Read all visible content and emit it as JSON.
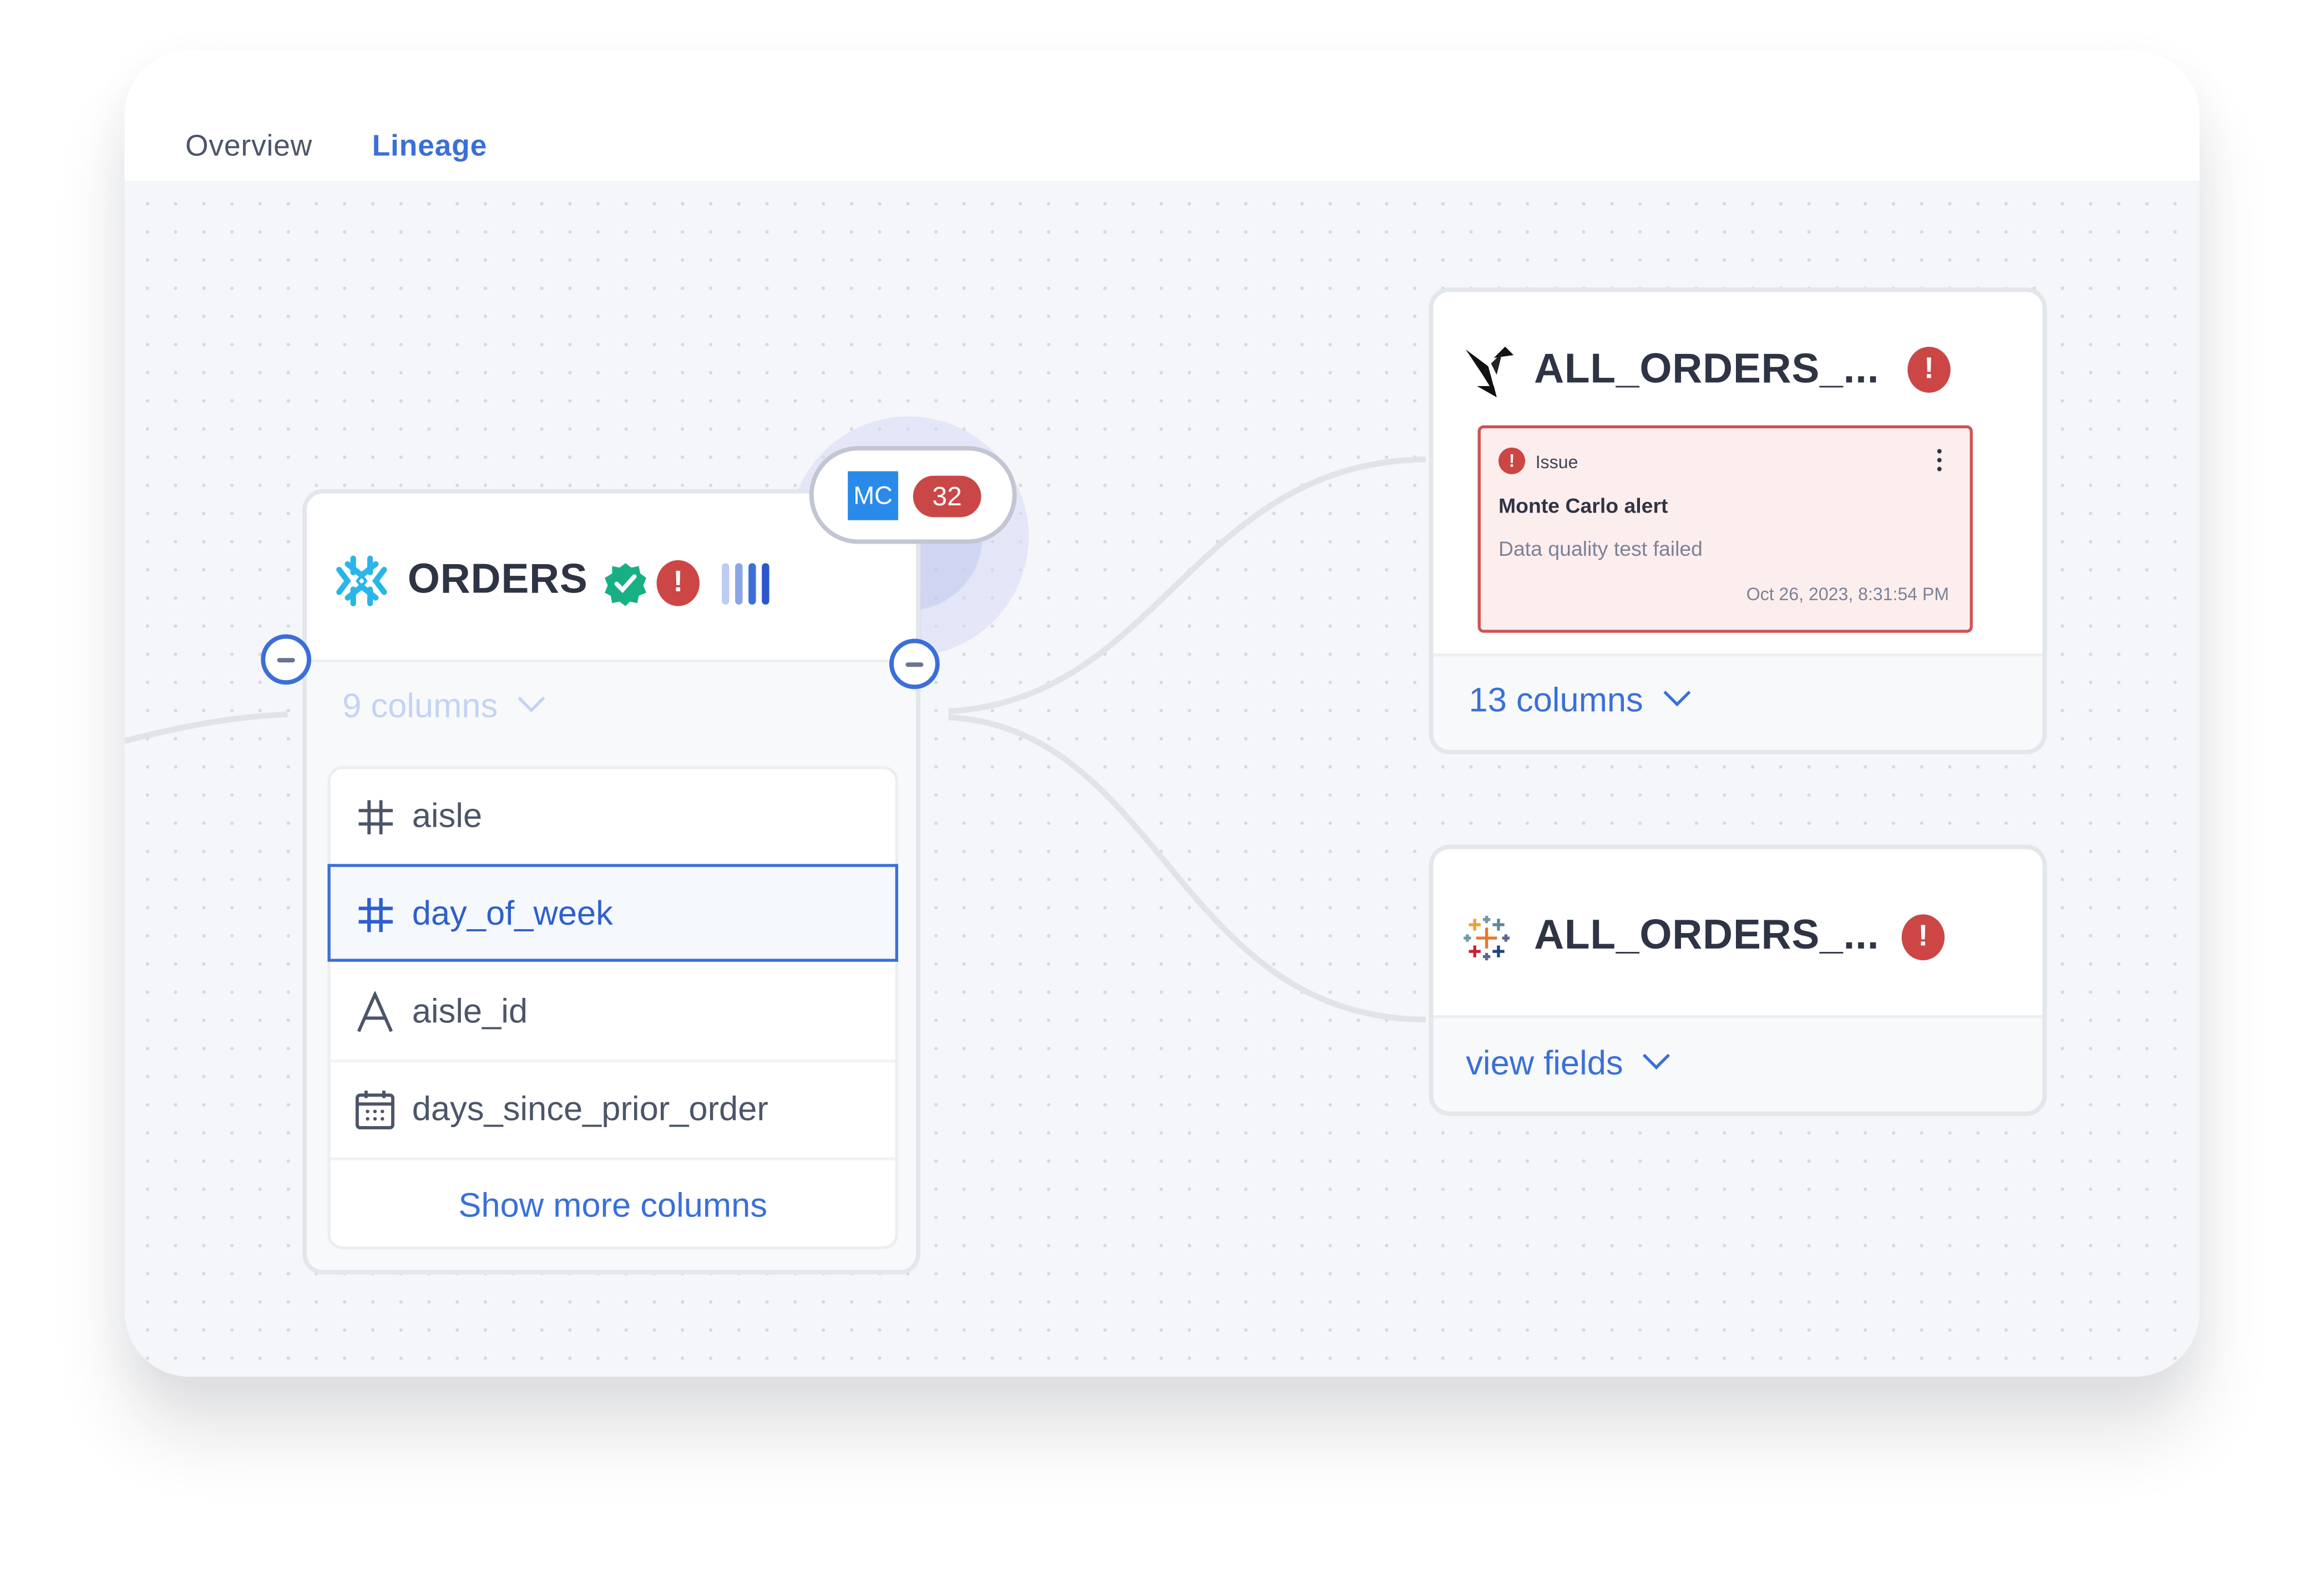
{
  "tabs": [
    {
      "label": "Overview",
      "active": false
    },
    {
      "label": "Lineage",
      "active": true
    }
  ],
  "colors": {
    "accent": "#3b6fd8",
    "alert": "#cc4646",
    "verified": "#17b084",
    "mc_brand": "#2a8aea",
    "canvas_bg": "#f4f6f9"
  },
  "orders_node": {
    "title": "ORDERS",
    "source_icon": "snowflake-icon",
    "verified_icon": "verified-badge-icon",
    "alert_symbol": "!",
    "importance_bars": {
      "filled": 4,
      "total": 4,
      "colors": [
        "#bcccf2",
        "#8aa6e6",
        "#3e6ed8",
        "#2a55cc"
      ]
    },
    "columns_toggle": "9 columns",
    "columns": [
      {
        "type_icon": "hash-icon",
        "name": "aisle",
        "selected": false
      },
      {
        "type_icon": "hash-icon",
        "name": "day_of_week",
        "selected": true
      },
      {
        "type_icon": "text-type-icon",
        "name": "aisle_id",
        "selected": false
      },
      {
        "type_icon": "calendar-icon",
        "name": "days_since_prior_order",
        "selected": false
      }
    ],
    "show_more": "Show more columns"
  },
  "mc_badge": {
    "logo_text": "MC",
    "count": "32"
  },
  "all_orders_1": {
    "title": "ALL_ORDERS_...",
    "source_icon": "hummingbird-icon",
    "alert_symbol": "!",
    "issue": {
      "label": "Issue",
      "title": "Monte Carlo alert",
      "description": "Data quality test failed",
      "timestamp": "Oct 26, 2023, 8:31:54 PM"
    },
    "columns_toggle": "13 columns"
  },
  "all_orders_2": {
    "title": "ALL_ORDERS_...",
    "source_icon": "tableau-icon",
    "alert_symbol": "!",
    "fields_toggle": "view fields"
  }
}
